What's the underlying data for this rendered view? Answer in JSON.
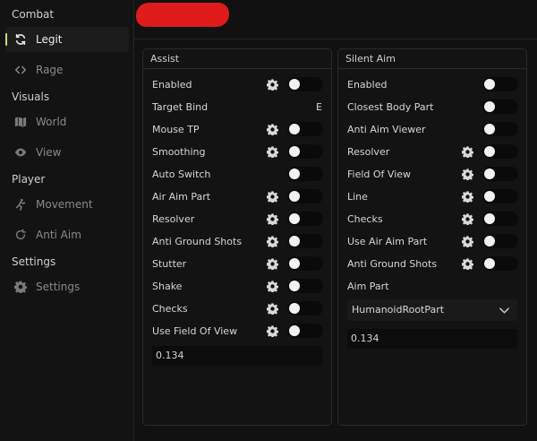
{
  "sidebar": {
    "sections": [
      {
        "label": "Combat",
        "items": [
          {
            "label": "Legit",
            "icon": "refresh-icon",
            "active": true
          },
          {
            "label": "Rage",
            "icon": "code-brackets-icon",
            "active": false
          }
        ]
      },
      {
        "label": "Visuals",
        "items": [
          {
            "label": "World",
            "icon": "map-icon",
            "active": false
          },
          {
            "label": "View",
            "icon": "eye-icon",
            "active": false
          }
        ]
      },
      {
        "label": "Player",
        "items": [
          {
            "label": "Movement",
            "icon": "running-person-icon",
            "active": false
          },
          {
            "label": "Anti Aim",
            "icon": "rotate-icon",
            "active": false
          }
        ]
      },
      {
        "label": "Settings",
        "items": [
          {
            "label": "Settings",
            "icon": "gear-icon",
            "active": false
          }
        ]
      }
    ]
  },
  "assist": {
    "title": "Assist",
    "rows": [
      {
        "label": "Enabled",
        "gear": true,
        "toggle": true
      },
      {
        "label": "Target Bind",
        "gear": false,
        "toggle": false,
        "keybind": "E"
      },
      {
        "label": "Mouse TP",
        "gear": true,
        "toggle": true
      },
      {
        "label": "Smoothing",
        "gear": true,
        "toggle": true
      },
      {
        "label": "Auto Switch",
        "gear": false,
        "toggle": true
      },
      {
        "label": "Air Aim Part",
        "gear": true,
        "toggle": true
      },
      {
        "label": "Resolver",
        "gear": true,
        "toggle": true
      },
      {
        "label": "Anti Ground Shots",
        "gear": true,
        "toggle": true
      },
      {
        "label": "Stutter",
        "gear": true,
        "toggle": true
      },
      {
        "label": "Shake",
        "gear": true,
        "toggle": true
      },
      {
        "label": "Checks",
        "gear": true,
        "toggle": true
      },
      {
        "label": "Use Field Of View",
        "gear": true,
        "toggle": true
      }
    ],
    "fov_value": "0.134"
  },
  "silent_aim": {
    "title": "Silent Aim",
    "rows": [
      {
        "label": "Enabled",
        "gear": false,
        "toggle": true
      },
      {
        "label": "Closest Body Part",
        "gear": false,
        "toggle": true
      },
      {
        "label": "Anti Aim Viewer",
        "gear": false,
        "toggle": true
      },
      {
        "label": "Resolver",
        "gear": true,
        "toggle": true
      },
      {
        "label": "Field Of View",
        "gear": true,
        "toggle": true
      },
      {
        "label": "Line",
        "gear": true,
        "toggle": true
      },
      {
        "label": "Checks",
        "gear": true,
        "toggle": true
      },
      {
        "label": "Use Air Aim Part",
        "gear": true,
        "toggle": true
      },
      {
        "label": "Anti Ground Shots",
        "gear": true,
        "toggle": true
      },
      {
        "label": "Aim Part",
        "gear": false,
        "toggle": false
      }
    ],
    "aim_part_value": "HumanoidRootPart",
    "fov_value": "0.134"
  },
  "colors": {
    "accent": "#c9e06b",
    "redaction": "#e01b1b",
    "background": "#111111"
  }
}
